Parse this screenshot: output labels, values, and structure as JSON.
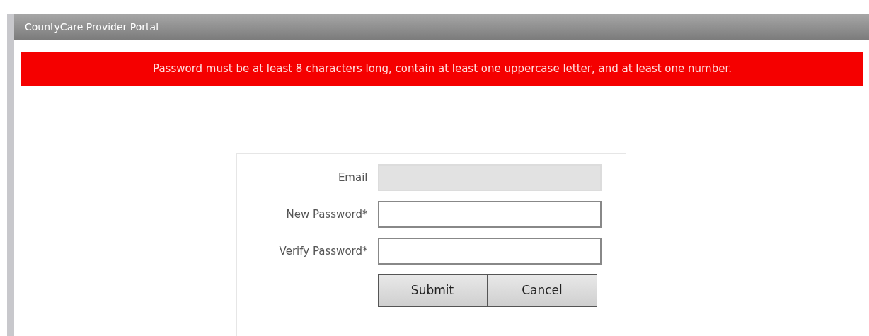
{
  "window": {
    "title": "CountyCare Provider Portal"
  },
  "alert": {
    "text": "Password must be at least 8 characters long, contain at least one uppercase letter, and at least one number."
  },
  "form": {
    "fields": [
      {
        "label": "Email",
        "disabled": true
      },
      {
        "label": "New Password*",
        "disabled": false
      },
      {
        "label": "Verify Password*",
        "disabled": false
      }
    ],
    "buttons": [
      "Submit",
      "Cancel"
    ]
  }
}
